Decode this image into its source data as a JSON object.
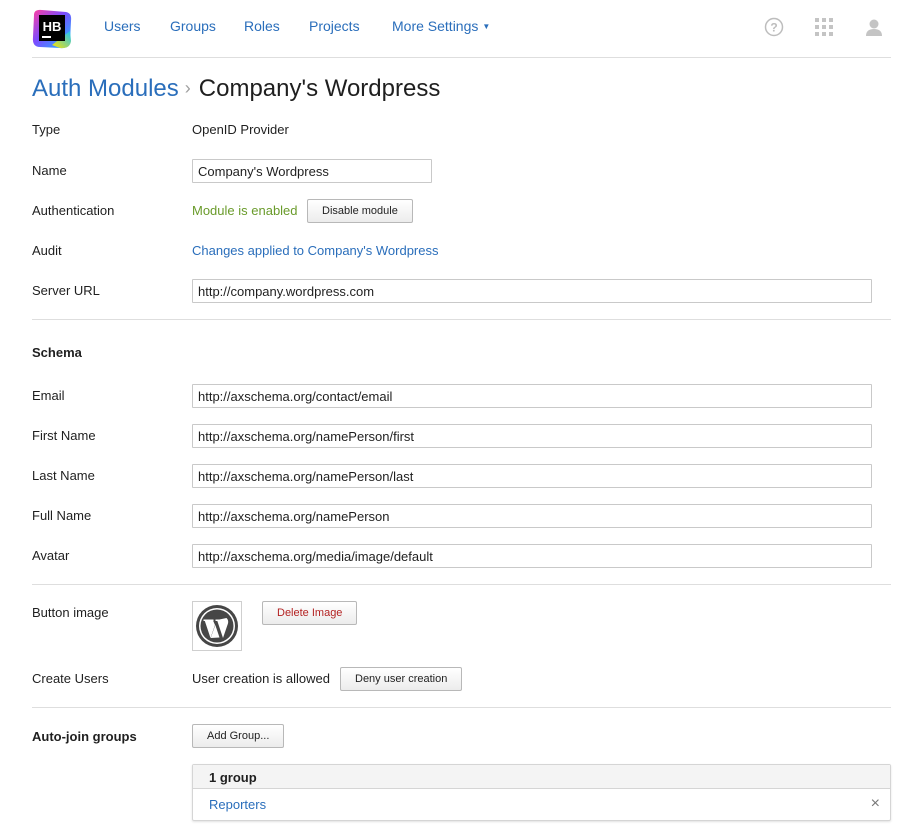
{
  "nav": {
    "logo_text": "HB",
    "items": [
      {
        "label": "Users"
      },
      {
        "label": "Groups"
      },
      {
        "label": "Roles"
      },
      {
        "label": "Projects"
      },
      {
        "label": "More Settings"
      }
    ],
    "icons": [
      "help-icon",
      "apps-grid-icon",
      "user-avatar-icon"
    ],
    "accent_color": "#2a6ebb"
  },
  "breadcrumb": {
    "parent": "Auth Modules",
    "separator": "›",
    "current": "Company's Wordpress"
  },
  "fields": {
    "type_label": "Type",
    "type_value": "OpenID Provider",
    "name_label": "Name",
    "name_value": "Company's Wordpress",
    "auth_label": "Authentication",
    "auth_status": "Module is enabled",
    "auth_status_color": "#6a9b2b",
    "auth_button": "Disable module",
    "audit_label": "Audit",
    "audit_link": "Changes applied to Company's Wordpress",
    "server_url_label": "Server URL",
    "server_url_value": "http://company.wordpress.com"
  },
  "schema": {
    "heading": "Schema",
    "email_label": "Email",
    "email_value": "http://axschema.org/contact/email",
    "first_name_label": "First Name",
    "first_name_value": "http://axschema.org/namePerson/first",
    "last_name_label": "Last Name",
    "last_name_value": "http://axschema.org/namePerson/last",
    "full_name_label": "Full Name",
    "full_name_value": "http://axschema.org/namePerson",
    "avatar_label": "Avatar",
    "avatar_value": "http://axschema.org/media/image/default"
  },
  "button_image": {
    "label": "Button image",
    "icon": "wordpress-logo-icon",
    "delete_button": "Delete Image",
    "delete_color": "#b32222"
  },
  "create_users": {
    "label": "Create Users",
    "status": "User creation is allowed",
    "button": "Deny user creation"
  },
  "auto_join": {
    "label": "Auto-join groups",
    "add_button": "Add Group...",
    "count_header": "1 group",
    "groups": [
      {
        "name": "Reporters",
        "remove_icon": "×"
      }
    ]
  }
}
